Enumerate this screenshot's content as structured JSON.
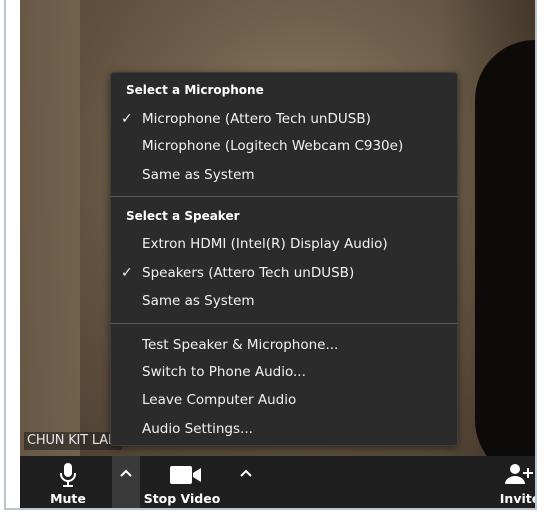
{
  "menu": {
    "microphone_title": "Select a Microphone",
    "microphones": [
      {
        "label": "Microphone (Attero Tech unDUSB)",
        "selected": true
      },
      {
        "label": "Microphone (Logitech Webcam C930e)",
        "selected": false
      },
      {
        "label": "Same as System",
        "selected": false
      }
    ],
    "speaker_title": "Select a Speaker",
    "speakers": [
      {
        "label": "Extron HDMI (Intel(R) Display Audio)",
        "selected": false
      },
      {
        "label": "Speakers (Attero Tech unDUSB)",
        "selected": true
      },
      {
        "label": "Same as System",
        "selected": false
      }
    ],
    "actions": [
      {
        "label": "Test Speaker & Microphone..."
      },
      {
        "label": "Switch to Phone Audio..."
      },
      {
        "label": "Leave Computer Audio"
      },
      {
        "label": "Audio Settings..."
      }
    ],
    "check_glyph": "✓"
  },
  "participant": {
    "name": "CHUN KIT LAM"
  },
  "toolbar": {
    "mute_label": "Mute",
    "mute_icon": "microphone-icon",
    "mic_arrow_icon": "chevron-up-icon",
    "video_label": "Stop Video",
    "video_icon": "video-camera-icon",
    "video_arrow_icon": "chevron-up-icon",
    "invite_label": "Invite",
    "invite_icon": "add-person-icon"
  },
  "colors": {
    "menu_bg": "#2b2b2b",
    "toolbar_bg": "#1f1f1f",
    "frame_border": "#b9c4ce"
  }
}
